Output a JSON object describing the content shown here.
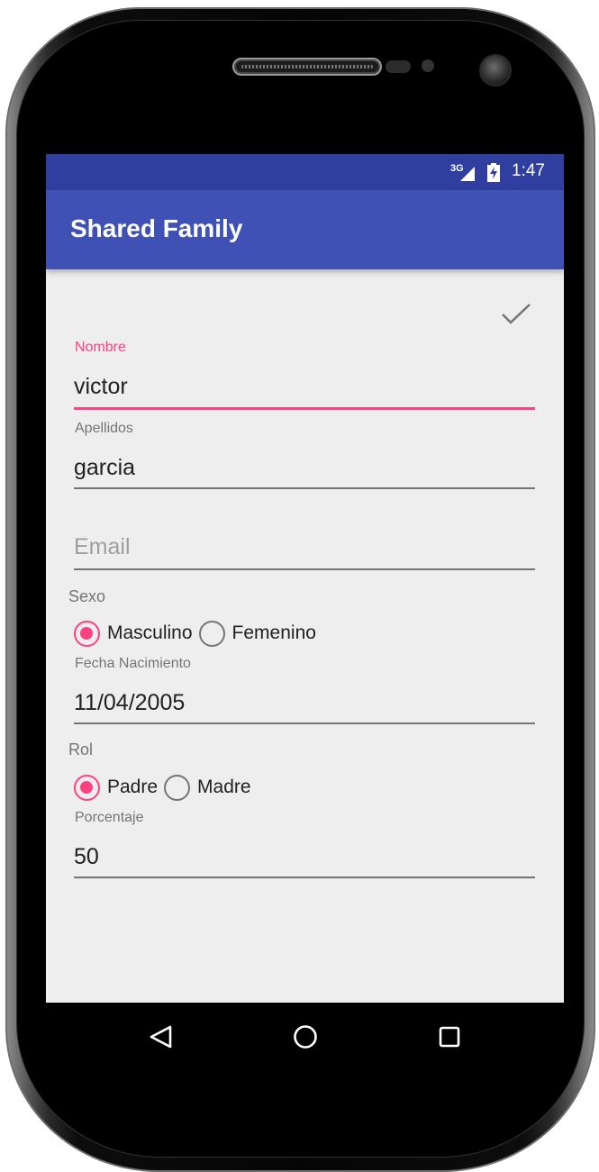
{
  "status_bar": {
    "network": "3G",
    "time": "1:47",
    "color": "#303f9f"
  },
  "app_bar": {
    "title": "Shared Family",
    "color": "#3f51b5",
    "action_icon": "check-icon"
  },
  "form": {
    "nombre": {
      "label": "Nombre",
      "value": "victor",
      "focused": true
    },
    "apellidos": {
      "label": "Apellidos",
      "value": "garcia"
    },
    "email": {
      "placeholder": "Email",
      "value": ""
    },
    "sexo": {
      "label": "Sexo",
      "options": [
        {
          "label": "Masculino",
          "checked": true
        },
        {
          "label": "Femenino",
          "checked": false
        }
      ]
    },
    "fecha_nacimiento": {
      "label": "Fecha Nacimiento",
      "value": "11/04/2005"
    },
    "rol": {
      "label": "Rol",
      "options": [
        {
          "label": "Padre",
          "checked": true
        },
        {
          "label": "Madre",
          "checked": false
        }
      ]
    },
    "porcentaje": {
      "label": "Porcentaje",
      "value": "50"
    }
  },
  "nav_bar": {
    "buttons": [
      "back-triangle-icon",
      "home-circle-icon",
      "recents-square-icon"
    ]
  },
  "colors": {
    "accent": "#ff4081",
    "background": "#eeeeee",
    "text_secondary": "#757575"
  }
}
